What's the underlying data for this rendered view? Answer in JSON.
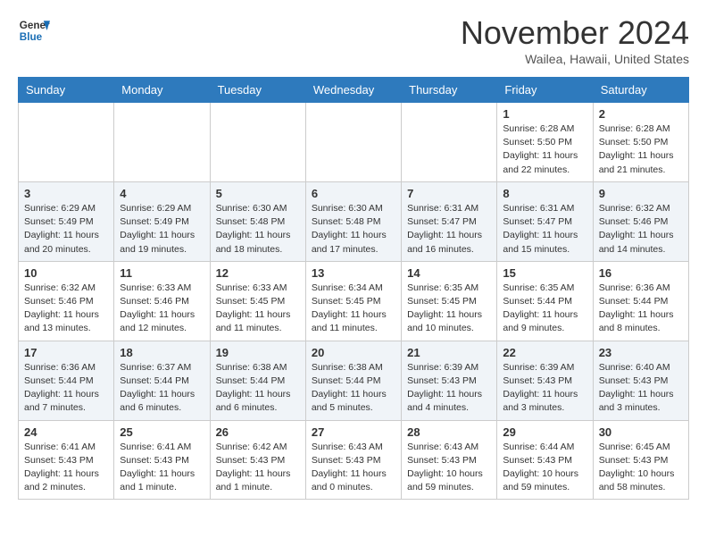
{
  "header": {
    "logo_line1": "General",
    "logo_line2": "Blue",
    "month": "November 2024",
    "location": "Wailea, Hawaii, United States"
  },
  "weekdays": [
    "Sunday",
    "Monday",
    "Tuesday",
    "Wednesday",
    "Thursday",
    "Friday",
    "Saturday"
  ],
  "weeks": [
    [
      {
        "day": "",
        "info": ""
      },
      {
        "day": "",
        "info": ""
      },
      {
        "day": "",
        "info": ""
      },
      {
        "day": "",
        "info": ""
      },
      {
        "day": "",
        "info": ""
      },
      {
        "day": "1",
        "info": "Sunrise: 6:28 AM\nSunset: 5:50 PM\nDaylight: 11 hours\nand 22 minutes."
      },
      {
        "day": "2",
        "info": "Sunrise: 6:28 AM\nSunset: 5:50 PM\nDaylight: 11 hours\nand 21 minutes."
      }
    ],
    [
      {
        "day": "3",
        "info": "Sunrise: 6:29 AM\nSunset: 5:49 PM\nDaylight: 11 hours\nand 20 minutes."
      },
      {
        "day": "4",
        "info": "Sunrise: 6:29 AM\nSunset: 5:49 PM\nDaylight: 11 hours\nand 19 minutes."
      },
      {
        "day": "5",
        "info": "Sunrise: 6:30 AM\nSunset: 5:48 PM\nDaylight: 11 hours\nand 18 minutes."
      },
      {
        "day": "6",
        "info": "Sunrise: 6:30 AM\nSunset: 5:48 PM\nDaylight: 11 hours\nand 17 minutes."
      },
      {
        "day": "7",
        "info": "Sunrise: 6:31 AM\nSunset: 5:47 PM\nDaylight: 11 hours\nand 16 minutes."
      },
      {
        "day": "8",
        "info": "Sunrise: 6:31 AM\nSunset: 5:47 PM\nDaylight: 11 hours\nand 15 minutes."
      },
      {
        "day": "9",
        "info": "Sunrise: 6:32 AM\nSunset: 5:46 PM\nDaylight: 11 hours\nand 14 minutes."
      }
    ],
    [
      {
        "day": "10",
        "info": "Sunrise: 6:32 AM\nSunset: 5:46 PM\nDaylight: 11 hours\nand 13 minutes."
      },
      {
        "day": "11",
        "info": "Sunrise: 6:33 AM\nSunset: 5:46 PM\nDaylight: 11 hours\nand 12 minutes."
      },
      {
        "day": "12",
        "info": "Sunrise: 6:33 AM\nSunset: 5:45 PM\nDaylight: 11 hours\nand 11 minutes."
      },
      {
        "day": "13",
        "info": "Sunrise: 6:34 AM\nSunset: 5:45 PM\nDaylight: 11 hours\nand 11 minutes."
      },
      {
        "day": "14",
        "info": "Sunrise: 6:35 AM\nSunset: 5:45 PM\nDaylight: 11 hours\nand 10 minutes."
      },
      {
        "day": "15",
        "info": "Sunrise: 6:35 AM\nSunset: 5:44 PM\nDaylight: 11 hours\nand 9 minutes."
      },
      {
        "day": "16",
        "info": "Sunrise: 6:36 AM\nSunset: 5:44 PM\nDaylight: 11 hours\nand 8 minutes."
      }
    ],
    [
      {
        "day": "17",
        "info": "Sunrise: 6:36 AM\nSunset: 5:44 PM\nDaylight: 11 hours\nand 7 minutes."
      },
      {
        "day": "18",
        "info": "Sunrise: 6:37 AM\nSunset: 5:44 PM\nDaylight: 11 hours\nand 6 minutes."
      },
      {
        "day": "19",
        "info": "Sunrise: 6:38 AM\nSunset: 5:44 PM\nDaylight: 11 hours\nand 6 minutes."
      },
      {
        "day": "20",
        "info": "Sunrise: 6:38 AM\nSunset: 5:44 PM\nDaylight: 11 hours\nand 5 minutes."
      },
      {
        "day": "21",
        "info": "Sunrise: 6:39 AM\nSunset: 5:43 PM\nDaylight: 11 hours\nand 4 minutes."
      },
      {
        "day": "22",
        "info": "Sunrise: 6:39 AM\nSunset: 5:43 PM\nDaylight: 11 hours\nand 3 minutes."
      },
      {
        "day": "23",
        "info": "Sunrise: 6:40 AM\nSunset: 5:43 PM\nDaylight: 11 hours\nand 3 minutes."
      }
    ],
    [
      {
        "day": "24",
        "info": "Sunrise: 6:41 AM\nSunset: 5:43 PM\nDaylight: 11 hours\nand 2 minutes."
      },
      {
        "day": "25",
        "info": "Sunrise: 6:41 AM\nSunset: 5:43 PM\nDaylight: 11 hours\nand 1 minute."
      },
      {
        "day": "26",
        "info": "Sunrise: 6:42 AM\nSunset: 5:43 PM\nDaylight: 11 hours\nand 1 minute."
      },
      {
        "day": "27",
        "info": "Sunrise: 6:43 AM\nSunset: 5:43 PM\nDaylight: 11 hours\nand 0 minutes."
      },
      {
        "day": "28",
        "info": "Sunrise: 6:43 AM\nSunset: 5:43 PM\nDaylight: 10 hours\nand 59 minutes."
      },
      {
        "day": "29",
        "info": "Sunrise: 6:44 AM\nSunset: 5:43 PM\nDaylight: 10 hours\nand 59 minutes."
      },
      {
        "day": "30",
        "info": "Sunrise: 6:45 AM\nSunset: 5:43 PM\nDaylight: 10 hours\nand 58 minutes."
      }
    ]
  ]
}
